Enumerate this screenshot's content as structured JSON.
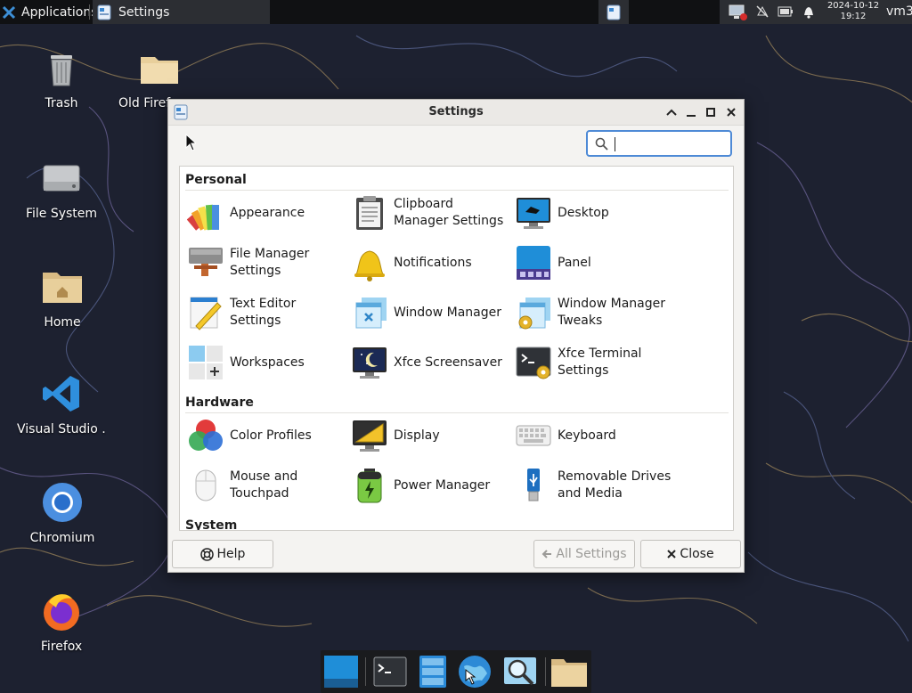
{
  "top_panel": {
    "applications_label": "Applications",
    "task_label": "Settings",
    "clock_date": "2024-10-12",
    "clock_time": "19:12",
    "user": "vm3"
  },
  "desktop": {
    "icons": [
      {
        "label": "Trash",
        "icon": "trash-icon"
      },
      {
        "label": "Old Firefox",
        "icon": "folder-icon"
      },
      {
        "label": "File System",
        "icon": "drive-icon"
      },
      {
        "label": "Home",
        "icon": "home-folder-icon"
      },
      {
        "label": "Visual Studio ...",
        "icon": "vscode-icon"
      },
      {
        "label": "Chromium",
        "icon": "chromium-icon"
      },
      {
        "label": "Firefox",
        "icon": "firefox-icon"
      }
    ]
  },
  "dialog": {
    "title": "Settings",
    "search": {
      "value": "",
      "placeholder": ""
    },
    "sections": [
      {
        "title": "Personal",
        "items": [
          {
            "label": "Appearance",
            "icon": "appearance-icon"
          },
          {
            "label": "Clipboard Manager Settings",
            "icon": "clipboard-icon"
          },
          {
            "label": "Desktop",
            "icon": "desktop-icon"
          },
          {
            "label": "File Manager Settings",
            "icon": "file-manager-icon"
          },
          {
            "label": "Notifications",
            "icon": "bell-icon"
          },
          {
            "label": "Panel",
            "icon": "panel-icon"
          },
          {
            "label": "Text Editor Settings",
            "icon": "text-editor-icon"
          },
          {
            "label": "Window Manager",
            "icon": "window-manager-icon"
          },
          {
            "label": "Window Manager Tweaks",
            "icon": "window-tweaks-icon"
          },
          {
            "label": "Workspaces",
            "icon": "workspaces-icon"
          },
          {
            "label": "Xfce Screensaver",
            "icon": "screensaver-icon"
          },
          {
            "label": "Xfce Terminal Settings",
            "icon": "terminal-settings-icon"
          }
        ]
      },
      {
        "title": "Hardware",
        "items": [
          {
            "label": "Color Profiles",
            "icon": "color-profiles-icon"
          },
          {
            "label": "Display",
            "icon": "display-icon"
          },
          {
            "label": "Keyboard",
            "icon": "keyboard-icon"
          },
          {
            "label": "Mouse and Touchpad",
            "icon": "mouse-icon"
          },
          {
            "label": "Power Manager",
            "icon": "battery-icon"
          },
          {
            "label": "Removable Drives and Media",
            "icon": "usb-icon"
          }
        ]
      },
      {
        "title": "System",
        "items": []
      }
    ],
    "buttons": {
      "help": "Help",
      "all_settings": "All Settings",
      "close": "Close"
    }
  },
  "dock": {
    "items": [
      "workspace-switcher-icon",
      "terminal-icon",
      "file-manager-window-icon",
      "web-browser-icon",
      "app-finder-icon",
      "folder-icon"
    ]
  }
}
